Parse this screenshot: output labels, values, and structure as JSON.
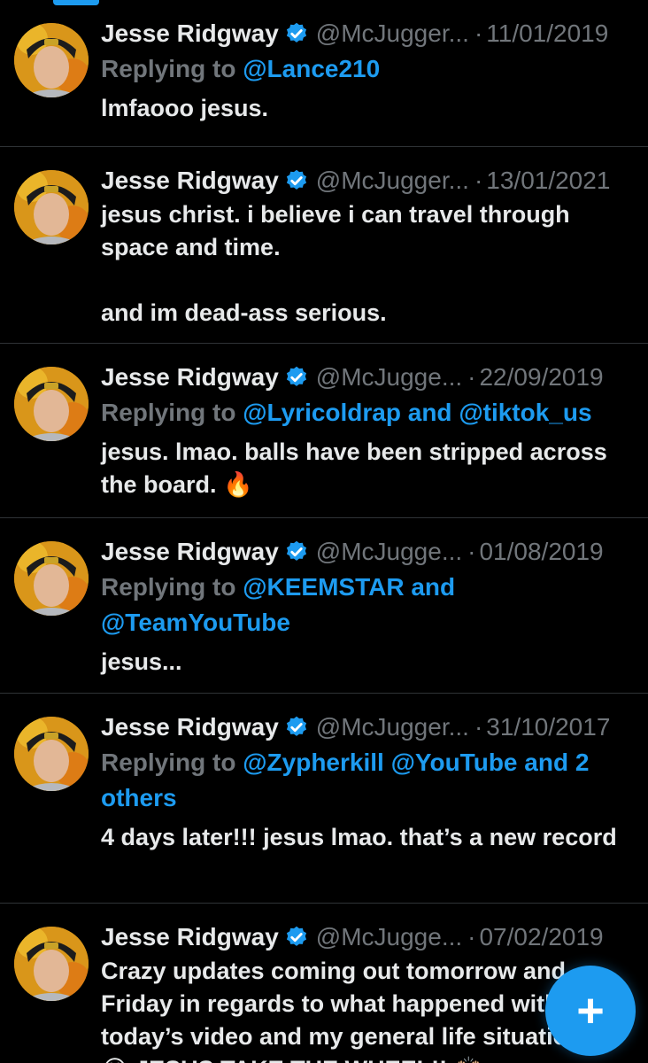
{
  "colors": {
    "background": "#000000",
    "text": "#e7e9ea",
    "muted": "#71767b",
    "accent": "#1d9bf0",
    "divider": "#2f3336"
  },
  "tweets": [
    {
      "name": "Jesse Ridgway",
      "handle": "@McJugger...",
      "date": "11/01/2019",
      "replying_prefix": "Replying to ",
      "mentions": "@Lance210",
      "text": "lmfaooo jesus."
    },
    {
      "name": "Jesse Ridgway",
      "handle": "@McJugger...",
      "date": "13/01/2021",
      "text": "jesus christ. i believe i can travel through space and time.\n\nand im dead-ass serious."
    },
    {
      "name": "Jesse Ridgway",
      "handle": "@McJugge...",
      "date": "22/09/2019",
      "replying_prefix": "Replying to ",
      "mentions": "@Lyricoldrap and @tiktok_us",
      "text": "jesus. lmao. balls have been stripped across the board. 🔥"
    },
    {
      "name": "Jesse Ridgway",
      "handle": "@McJugge...",
      "date": "01/08/2019",
      "replying_prefix": "Replying to ",
      "mentions": "@KEEMSTAR and @TeamYouTube",
      "text": "jesus..."
    },
    {
      "name": "Jesse Ridgway",
      "handle": "@McJugger...",
      "date": "31/10/2017",
      "replying_prefix": "Replying to ",
      "mentions": "@Zypherkill @YouTube and 2 others",
      "text": "4 days later!!! jesus lmao. that’s a new record"
    },
    {
      "name": "Jesse Ridgway",
      "handle": "@McJugge...",
      "date": "07/02/2019",
      "text": "Crazy updates coming out tomorrow and Friday in regards to what happened with today’s video and my general life situation. 😂😂 JESUS TAKE THE WHEEL!! 🙌🏼"
    }
  ],
  "fab": {
    "icon": "plus-icon",
    "label": "+"
  }
}
